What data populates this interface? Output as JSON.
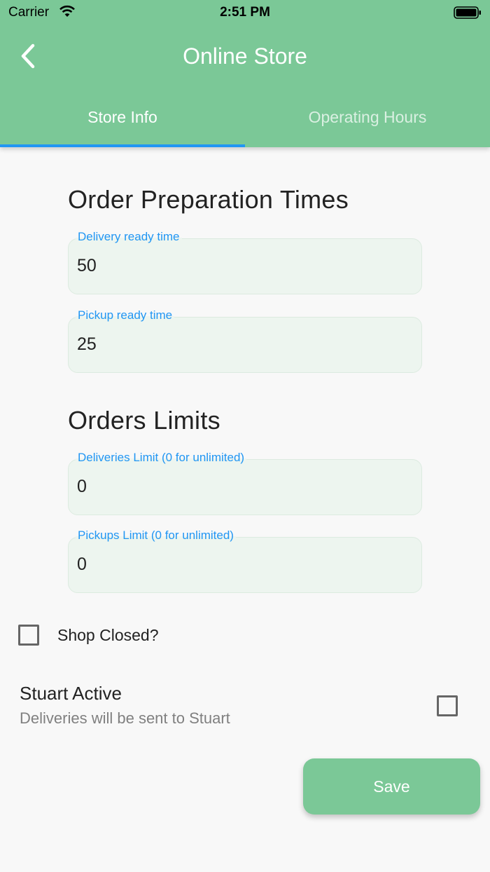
{
  "status_bar": {
    "carrier": "Carrier",
    "time": "2:51 PM"
  },
  "app_bar": {
    "title": "Online Store",
    "back_icon": "chevron-left-icon"
  },
  "tabs": [
    {
      "label": "Store Info",
      "selected": true
    },
    {
      "label": "Operating Hours",
      "selected": false
    }
  ],
  "preparation": {
    "title": "Order Preparation Times",
    "delivery": {
      "label": "Delivery ready time",
      "value": "50"
    },
    "pickup": {
      "label": "Pickup ready time",
      "value": "25"
    }
  },
  "limits": {
    "title": "Orders Limits",
    "deliveries": {
      "label": "Deliveries Limit (0 for unlimited)",
      "value": "0"
    },
    "pickups": {
      "label": "Pickups Limit (0 for unlimited)",
      "value": "0"
    }
  },
  "shop_closed": {
    "label": "Shop Closed?",
    "checked": false
  },
  "stuart": {
    "title": "Stuart Active",
    "subtitle": "Deliveries will be sent to Stuart",
    "checked": false
  },
  "save_label": "Save",
  "colors": {
    "primary": "#7bc897",
    "tab_indicator": "#2196f3",
    "field_label": "#2196f3",
    "field_fill": "#edf5ef"
  }
}
